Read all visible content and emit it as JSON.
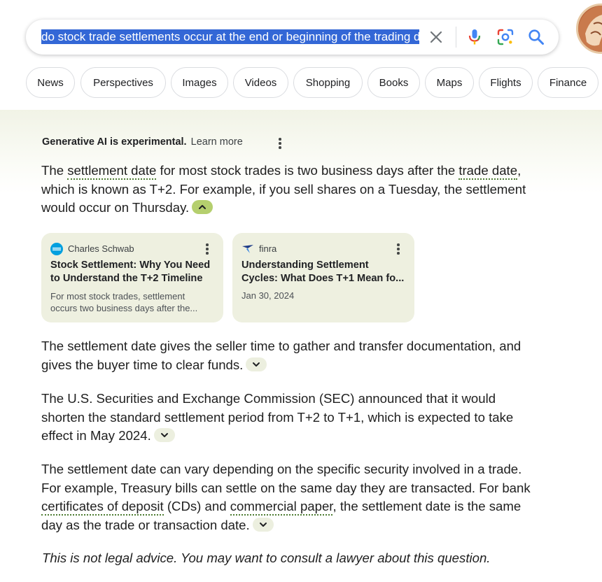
{
  "search": {
    "query": "do stock trade settlements occur at the end or beginning of the trading day"
  },
  "chips": [
    {
      "label": "News"
    },
    {
      "label": "Perspectives"
    },
    {
      "label": "Images"
    },
    {
      "label": "Videos"
    },
    {
      "label": "Shopping"
    },
    {
      "label": "Books"
    },
    {
      "label": "Maps"
    },
    {
      "label": "Flights"
    },
    {
      "label": "Finance"
    }
  ],
  "ai_overview": {
    "experimental_label": "Generative AI is experimental.",
    "learn_more": "Learn more",
    "p1": {
      "t1": "The ",
      "term1": "settlement date",
      "t2": " for most stock trades is two business days after the ",
      "term2": "trade date",
      "t3": ", which is known as T+2. For example, if you sell shares on a Tuesday, the settlement would occur on Thursday."
    },
    "cards": [
      {
        "source": "Charles Schwab",
        "title": "Stock Settlement: Why You Need to Understand the T+2 Timeline",
        "snippet": "For most stock trades, settlement occurs two business days after the..."
      },
      {
        "source": "finra",
        "title": "Understanding Settlement Cycles: What Does T+1 Mean fo...",
        "date": "Jan 30, 2024"
      }
    ],
    "p2": "The settlement date gives the seller time to gather and transfer documentation, and gives the buyer time to clear funds.",
    "p3": "The U.S. Securities and Exchange Commission (SEC) announced that it would shorten the standard settlement period from T+2 to T+1, which is expected to take effect in May 2024.",
    "p4": {
      "t1": "The settlement date can vary depending on the specific security involved in a trade. For example, Treasury bills can settle on the same day they are transacted. For bank ",
      "term1": "certificates of deposit",
      "t2": " (CDs) and ",
      "term2": "commercial paper",
      "t3": ", the settlement date is the same day as the trade or transaction date."
    },
    "disclaimer": "This is not legal advice. You may want to consult a lawyer about this question."
  },
  "colors": {
    "selection": "#3367d6",
    "panel_tint": "#f1f3e6",
    "card_bg": "#eef0e0",
    "toggle_active": "#b5cf6e",
    "term_underline": "#4d7c32"
  },
  "icons": [
    "clear-icon",
    "microphone-icon",
    "google-lens-icon",
    "search-icon",
    "more-vert-icon",
    "chevron-up-icon",
    "chevron-down-icon",
    "charles-schwab-logo",
    "finra-logo"
  ]
}
